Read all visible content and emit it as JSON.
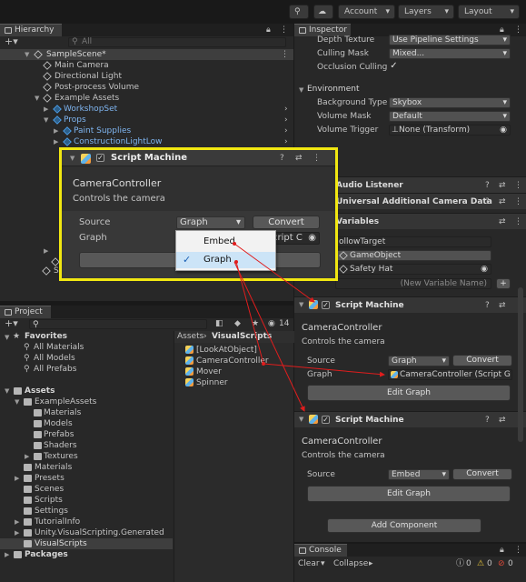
{
  "toolbar": {
    "account": "Account",
    "layers": "Layers",
    "layout": "Layout"
  },
  "hierarchy": {
    "tab": "Hierarchy",
    "search_placeholder": "All",
    "items": [
      "SampleScene*",
      "Main Camera",
      "Directional Light",
      "Post-process Volume",
      "Example Assets",
      "WorkshopSet",
      "Props",
      "Paint Supplies",
      "ConstructionLightLow"
    ],
    "partial_item": "S"
  },
  "inspector": {
    "tab": "Inspector",
    "camera": {
      "depth_texture": {
        "label": "Depth Texture",
        "value": "Use Pipeline Settings"
      },
      "culling_mask": {
        "label": "Culling Mask",
        "value": "Mixed..."
      },
      "occlusion_culling": {
        "label": "Occlusion Culling",
        "check": "✓"
      }
    },
    "environment": {
      "header": "Environment",
      "background_type": {
        "label": "Background Type",
        "value": "Skybox"
      },
      "volume_mask": {
        "label": "Volume Mask",
        "value": "Default"
      },
      "volume_trigger": {
        "label": "Volume Trigger",
        "value": "None (Transform)"
      }
    },
    "audio_listener": "Audio Listener",
    "urp_camera_data": "Universal Additional Camera Data",
    "variables": {
      "header": "Variables",
      "name": "ollowTarget",
      "type": "GameObject",
      "value": "Safety Hat",
      "new_variable_placeholder": "(New Variable Name)",
      "add": "+"
    },
    "script_machine_1": {
      "title": "Script Machine",
      "check": "✓",
      "name": "CameraController",
      "description": "Controls the camera",
      "source_label": "Source",
      "source_value": "Graph",
      "convert": "Convert",
      "graph_label": "Graph",
      "graph_value": "CameraController (Script G",
      "edit_graph": "Edit Graph"
    },
    "script_machine_2": {
      "title": "Script Machine",
      "check": "✓",
      "name": "CameraController",
      "description": "Controls the camera",
      "source_label": "Source",
      "source_value": "Embed",
      "convert": "Convert",
      "edit_graph": "Edit Graph"
    },
    "add_component": "Add Component"
  },
  "overlay": {
    "title": "Script Machine",
    "check": "✓",
    "name": "CameraController",
    "description": "Controls the camera",
    "source_label": "Source",
    "source_value": "Graph",
    "convert": "Convert",
    "graph_label": "Graph",
    "graph_field_fragment": "cript C",
    "popup_options": [
      "Embed",
      "Graph"
    ],
    "popup_selected_check": "✓"
  },
  "project": {
    "tab": "Project",
    "item_count": "14",
    "favorites": {
      "label": "Favorites",
      "items": [
        "All Materials",
        "All Models",
        "All Prefabs"
      ]
    },
    "assets": {
      "label": "Assets",
      "children": [
        "ExampleAssets",
        "Materials",
        "Models",
        "Prefabs",
        "Shaders",
        "Textures",
        "Materials",
        "Presets",
        "Scenes",
        "Scripts",
        "Settings",
        "TutorialInfo",
        "Unity.VisualScripting.Generated",
        "VisualScripts"
      ]
    },
    "packages": "Packages",
    "breadcrumb": {
      "root": "Assets",
      "sep": "›",
      "current": "VisualScripts"
    },
    "files": [
      "[LookAtObject]",
      "CameraController",
      "Mover",
      "Spinner"
    ]
  },
  "console": {
    "tab": "Console",
    "clear": "Clear",
    "collapse": "Collapse",
    "counts": [
      "0",
      "0",
      "0"
    ]
  },
  "colors": {
    "highlight": "#f1e711",
    "arrow": "#e01d1d",
    "selection": "#2c5d87"
  }
}
